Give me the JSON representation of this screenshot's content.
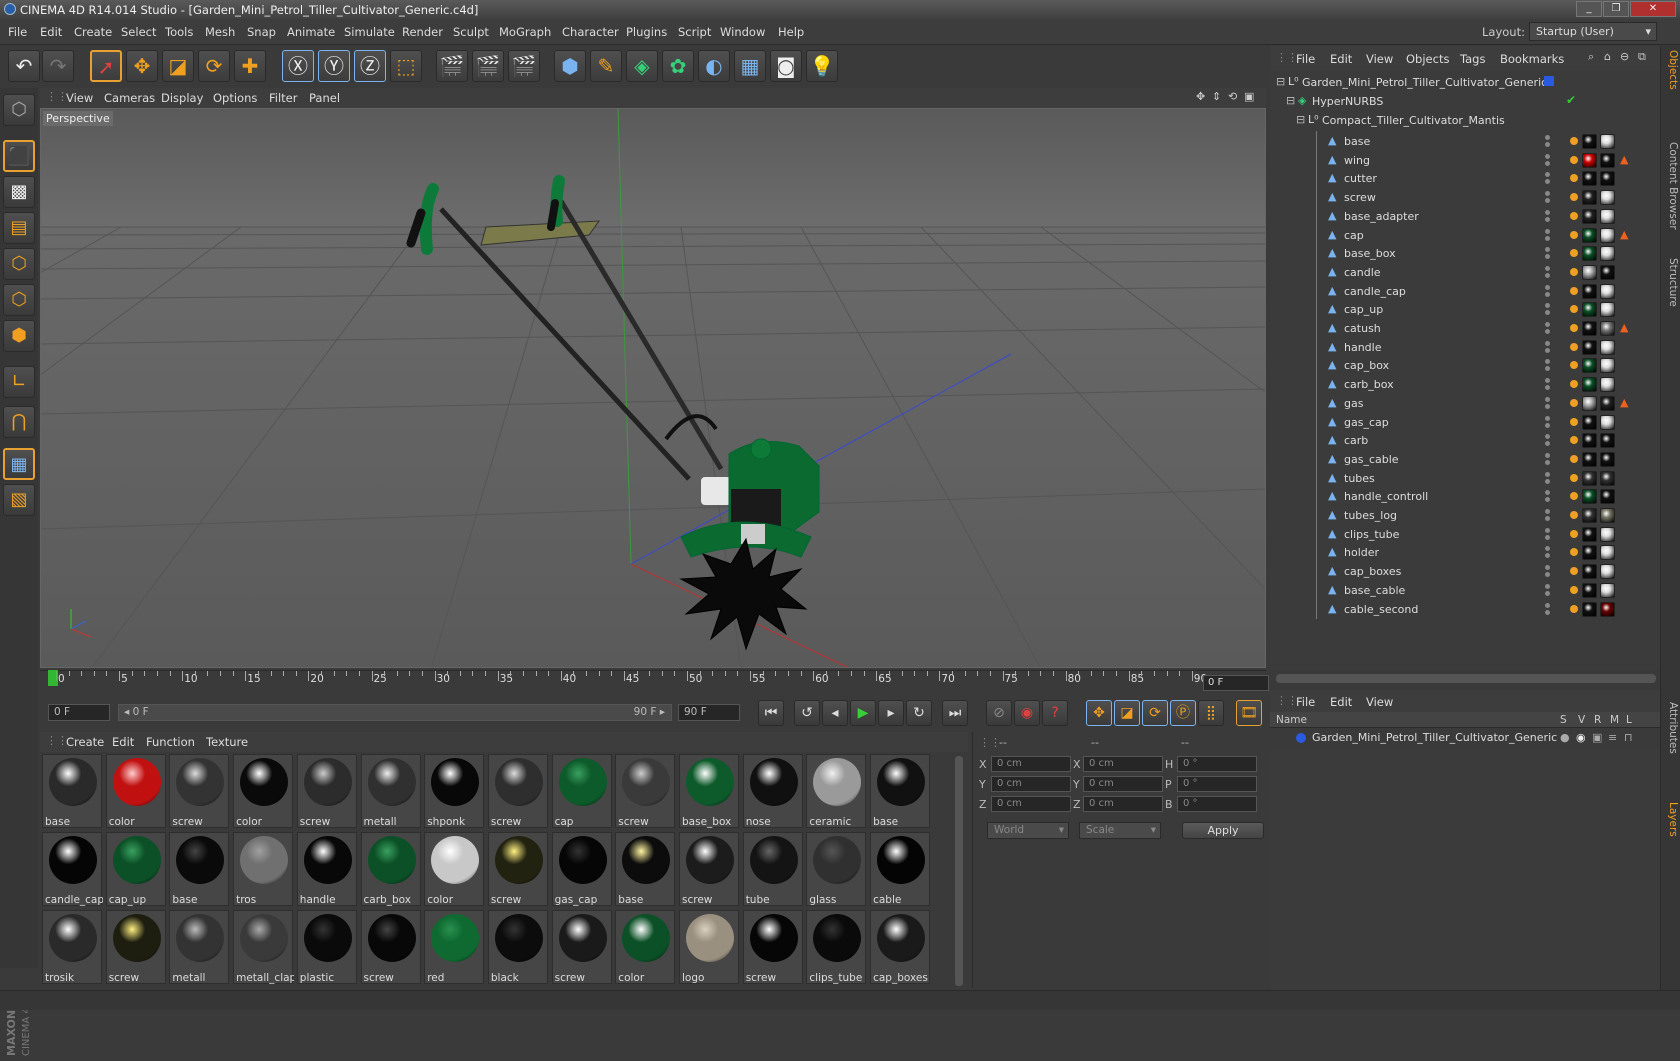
{
  "window": {
    "title": "CINEMA 4D R14.014 Studio - [Garden_Mini_Petrol_Tiller_Cultivator_Generic.c4d]",
    "controls": [
      "_",
      "❐",
      "✕"
    ]
  },
  "menu": [
    "File",
    "Edit",
    "Create",
    "Select",
    "Tools",
    "Mesh",
    "Snap",
    "Animate",
    "Simulate",
    "Render",
    "Sculpt",
    "MoGraph",
    "Character",
    "Plugins",
    "Script",
    "Window",
    "Help"
  ],
  "layout": {
    "label": "Layout:",
    "value": "Startup (User)"
  },
  "viewport": {
    "menu": [
      "View",
      "Cameras",
      "Display",
      "Options",
      "Filter",
      "Panel"
    ],
    "label": "Perspective"
  },
  "timeline": {
    "ticks": [
      "0",
      "5",
      "10",
      "15",
      "20",
      "25",
      "30",
      "35",
      "40",
      "45",
      "50",
      "55",
      "60",
      "65",
      "70",
      "75",
      "80",
      "85",
      "90"
    ],
    "current_frame": "0 F"
  },
  "transport": {
    "start": "0 F",
    "range_start": "◂ 0 F",
    "range_end": "90 F ▸",
    "end": "90 F"
  },
  "materials": {
    "menu": [
      "Create",
      "Edit",
      "Function",
      "Texture"
    ],
    "items": [
      {
        "name": "base",
        "color": "#2a2a2a",
        "hl": "#ffffff"
      },
      {
        "name": "color",
        "color": "#c01010",
        "hl": "#ffcccc"
      },
      {
        "name": "screw",
        "color": "#333333",
        "hl": "#dddddd"
      },
      {
        "name": "color",
        "color": "#0a0a0a",
        "hl": "#ffffff"
      },
      {
        "name": "screw",
        "color": "#2c2c2c",
        "hl": "#cccccc"
      },
      {
        "name": "metall",
        "color": "#303030",
        "hl": "#eeeeee"
      },
      {
        "name": "shponk",
        "color": "#080808",
        "hl": "#ffffff"
      },
      {
        "name": "screw",
        "color": "#2e2e2e",
        "hl": "#dddddd"
      },
      {
        "name": "cap",
        "color": "#0d5a2a",
        "hl": "#3aa060"
      },
      {
        "name": "screw",
        "color": "#3a3a3a",
        "hl": "#cccccc"
      },
      {
        "name": "base_box",
        "color": "#0d5a2a",
        "hl": "#ffffff"
      },
      {
        "name": "nose",
        "color": "#101010",
        "hl": "#ffffff"
      },
      {
        "name": "ceramic",
        "color": "#9a9a9a",
        "hl": "#f0f0f0"
      },
      {
        "name": "base",
        "color": "#111111",
        "hl": "#ffffff"
      },
      {
        "name": "candle_cap",
        "color": "#050505",
        "hl": "#ffffff"
      },
      {
        "name": "cap_up",
        "color": "#0b5026",
        "hl": "#3aa060"
      },
      {
        "name": "base",
        "color": "#0a0a0a",
        "hl": "#444444"
      },
      {
        "name": "tros",
        "color": "#707070",
        "hl": "#a0a0a0"
      },
      {
        "name": "handle",
        "color": "#080808",
        "hl": "#ffffff"
      },
      {
        "name": "carb_box",
        "color": "#0b5026",
        "hl": "#3aa060"
      },
      {
        "name": "color",
        "color": "#c8c8c8",
        "hl": "#ffffff"
      },
      {
        "name": "screw",
        "color": "#222211",
        "hl": "#fff080"
      },
      {
        "name": "gas_cap",
        "color": "#060606",
        "hl": "#333333"
      },
      {
        "name": "base",
        "color": "#0c0c0c",
        "hl": "#fff4a0"
      },
      {
        "name": "screw",
        "color": "#1c1c1c",
        "hl": "#ffffff"
      },
      {
        "name": "tube",
        "color": "#141414",
        "hl": "#666666"
      },
      {
        "name": "glass",
        "color": "#303030",
        "hl": "#555555"
      },
      {
        "name": "cable",
        "color": "#040404",
        "hl": "#ffffff"
      },
      {
        "name": "trosik",
        "color": "#2a2a2a",
        "hl": "#ffffff"
      },
      {
        "name": "screw",
        "color": "#1e1e10",
        "hl": "#fff080"
      },
      {
        "name": "metall",
        "color": "#333333",
        "hl": "#bbbbbb"
      },
      {
        "name": "metall_clap",
        "color": "#3a3a3a",
        "hl": "#aaaaaa"
      },
      {
        "name": "plastic",
        "color": "#0a0a0a",
        "hl": "#333333"
      },
      {
        "name": "screw",
        "color": "#080808",
        "hl": "#444444"
      },
      {
        "name": "red",
        "color": "#0e6a30",
        "hl": "#2a9050"
      },
      {
        "name": "black",
        "color": "#0c0c0c",
        "hl": "#333333"
      },
      {
        "name": "screw",
        "color": "#1a1a1a",
        "hl": "#ffffff"
      },
      {
        "name": "color",
        "color": "#0b5026",
        "hl": "#ffffff"
      },
      {
        "name": "logo",
        "color": "#9a9080",
        "hl": "#d8d0c0"
      },
      {
        "name": "screw",
        "color": "#060606",
        "hl": "#ffffff"
      },
      {
        "name": "clips_tube",
        "color": "#0a0a0a",
        "hl": "#333333"
      },
      {
        "name": "cap_boxes",
        "color": "#1a1a1a",
        "hl": "#ffffff"
      }
    ]
  },
  "attributes": {
    "header": [
      "--",
      "--",
      "--"
    ],
    "rows": [
      {
        "a": "X",
        "av": "0 cm",
        "b": "X",
        "bv": "0 cm",
        "c": "H",
        "cv": "0 °"
      },
      {
        "a": "Y",
        "av": "0 cm",
        "b": "Y",
        "bv": "0 cm",
        "c": "P",
        "cv": "0 °"
      },
      {
        "a": "Z",
        "av": "0 cm",
        "b": "Z",
        "bv": "0 cm",
        "c": "B",
        "cv": "0 °"
      }
    ],
    "world": "World",
    "scale": "Scale",
    "apply": "Apply"
  },
  "objects": {
    "menu": [
      "File",
      "Edit",
      "View",
      "Objects",
      "Tags",
      "Bookmarks"
    ],
    "root": "Garden_Mini_Petrol_Tiller_Cultivator_Generic",
    "nurbs": "HyperNURBS",
    "group": "Compact_Tiller_Cultivator_Mantis",
    "children": [
      {
        "name": "base",
        "tags": [
          "#111",
          "#ddd"
        ],
        "warn": false
      },
      {
        "name": "wing",
        "tags": [
          "#c00",
          "#111"
        ],
        "warn": true
      },
      {
        "name": "cutter",
        "tags": [
          "#111",
          "#111"
        ],
        "warn": false
      },
      {
        "name": "screw",
        "tags": [
          "#222",
          "#ddd"
        ],
        "warn": false
      },
      {
        "name": "base_adapter",
        "tags": [
          "#222",
          "#ddd"
        ],
        "warn": false
      },
      {
        "name": "cap",
        "tags": [
          "#0b5026",
          "#ddd"
        ],
        "warn": true
      },
      {
        "name": "base_box",
        "tags": [
          "#0b5026",
          "#ddd"
        ],
        "warn": false
      },
      {
        "name": "candle",
        "tags": [
          "#aaa",
          "#111"
        ],
        "warn": false
      },
      {
        "name": "candle_cap",
        "tags": [
          "#111",
          "#ddd"
        ],
        "warn": false
      },
      {
        "name": "cap_up",
        "tags": [
          "#0b5026",
          "#ddd"
        ],
        "warn": false
      },
      {
        "name": "catush",
        "tags": [
          "#111",
          "#777"
        ],
        "warn": true
      },
      {
        "name": "handle",
        "tags": [
          "#111",
          "#ddd"
        ],
        "warn": false
      },
      {
        "name": "cap_box",
        "tags": [
          "#0b5026",
          "#ddd"
        ],
        "warn": false
      },
      {
        "name": "carb_box",
        "tags": [
          "#0b5026",
          "#ddd"
        ],
        "warn": false
      },
      {
        "name": "gas",
        "tags": [
          "#aaa",
          "#222"
        ],
        "warn": true
      },
      {
        "name": "gas_cap",
        "tags": [
          "#111",
          "#ddd"
        ],
        "warn": false
      },
      {
        "name": "carb",
        "tags": [
          "#111",
          "#111"
        ],
        "warn": false
      },
      {
        "name": "gas_cable",
        "tags": [
          "#111",
          "#111"
        ],
        "warn": false
      },
      {
        "name": "tubes",
        "tags": [
          "#333",
          "#333"
        ],
        "warn": false
      },
      {
        "name": "handle_controll",
        "tags": [
          "#0b5026",
          "#111"
        ],
        "warn": false
      },
      {
        "name": "tubes_log",
        "tags": [
          "#333",
          "#776"
        ],
        "warn": false
      },
      {
        "name": "clips_tube",
        "tags": [
          "#111",
          "#ddd"
        ],
        "warn": false
      },
      {
        "name": "holder",
        "tags": [
          "#111",
          "#ddd"
        ],
        "warn": false
      },
      {
        "name": "cap_boxes",
        "tags": [
          "#111",
          "#ddd"
        ],
        "warn": false
      },
      {
        "name": "base_cable",
        "tags": [
          "#111",
          "#ddd"
        ],
        "warn": false
      },
      {
        "name": "cable_second",
        "tags": [
          "#111",
          "#600"
        ],
        "warn": false
      }
    ]
  },
  "layers": {
    "menu": [
      "File",
      "Edit",
      "View"
    ],
    "columns": [
      "Name",
      "S",
      "V",
      "R",
      "M",
      "L"
    ],
    "item": "Garden_Mini_Petrol_Tiller_Cultivator_Generic"
  },
  "sidetabs": [
    "Objects",
    "Content Browser",
    "Structure",
    "Attributes",
    "Layers"
  ],
  "brand": {
    "line1": "MAXON",
    "line2": "CINEMA 4D"
  }
}
